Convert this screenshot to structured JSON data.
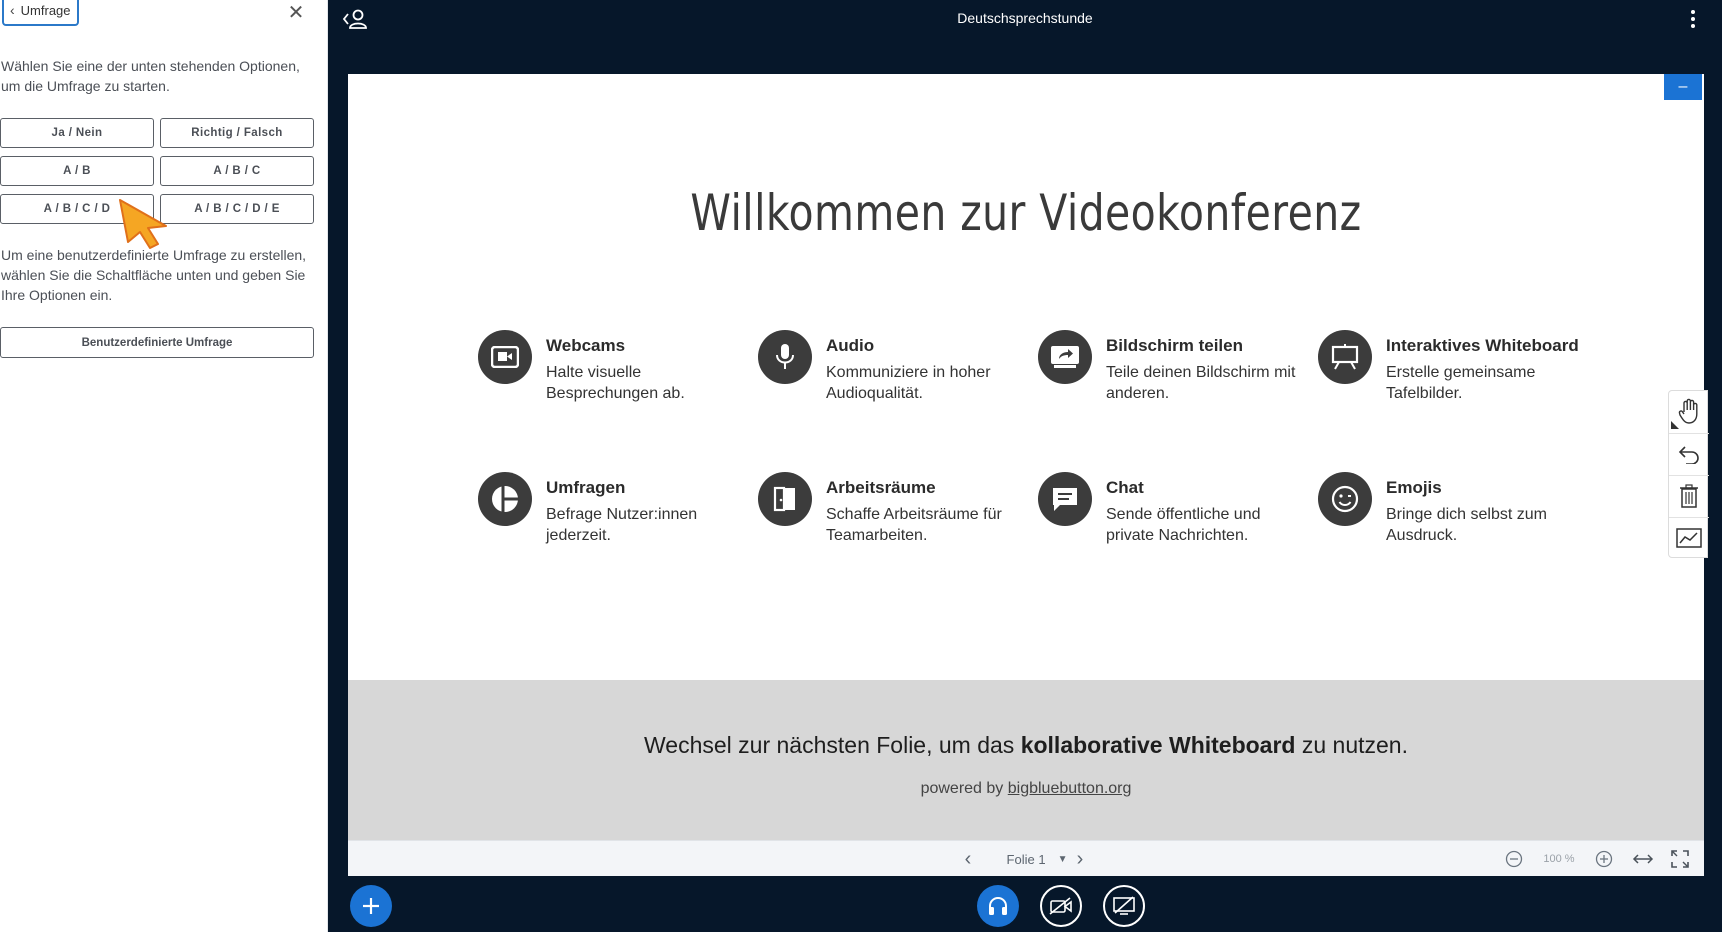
{
  "sidebar": {
    "back_label": "Umfrage",
    "intro": "Wählen Sie eine der unten stehenden Optionen, um die Umfrage zu starten.",
    "options": [
      "Ja / Nein",
      "Richtig / Falsch",
      "A / B",
      "A / B / C",
      "A / B / C / D",
      "A / B / C / D / E"
    ],
    "custom_intro": "Um eine benutzerdefinierte Umfrage zu erstellen, wählen Sie die Schaltfläche unten und geben Sie Ihre Optionen ein.",
    "custom_button": "Benutzerdefinierte Umfrage"
  },
  "topbar": {
    "title": "Deutschsprechstunde"
  },
  "slide": {
    "title": "Willkommen zur Videokonferenz",
    "features": [
      {
        "title": "Webcams",
        "desc": "Halte visuelle Besprechungen ab.",
        "icon": "webcam-icon"
      },
      {
        "title": "Audio",
        "desc": "Kommuniziere in hoher Audioqualität.",
        "icon": "microphone-icon"
      },
      {
        "title": "Bildschirm teilen",
        "desc": "Teile deinen Bildschirm mit anderen.",
        "icon": "screen-share-icon"
      },
      {
        "title": "Interaktives Whiteboard",
        "desc": "Erstelle gemeinsame Tafelbilder.",
        "icon": "whiteboard-icon"
      },
      {
        "title": "Umfragen",
        "desc": "Befrage Nutzer:innen jederzeit.",
        "icon": "poll-icon"
      },
      {
        "title": "Arbeitsräume",
        "desc": "Schaffe Arbeitsräume für Teamarbeiten.",
        "icon": "breakout-room-icon"
      },
      {
        "title": "Chat",
        "desc": "Sende öffentliche und private Nachrichten.",
        "icon": "chat-icon"
      },
      {
        "title": "Emojis",
        "desc": "Bringe dich selbst zum Ausdruck.",
        "icon": "emoji-icon"
      }
    ],
    "footer_pre": "Wechsel zur nächsten Folie, um das ",
    "footer_bold": "kollaborative Whiteboard",
    "footer_post": " zu nutzen.",
    "powered_by": "powered by ",
    "powered_link": "bigbluebutton.org"
  },
  "controls": {
    "slide_label": "Folie 1",
    "zoom_label": "100 %"
  },
  "colors": {
    "accent": "#1b73d4",
    "background": "#06172a",
    "cursor": "#f5a623"
  }
}
